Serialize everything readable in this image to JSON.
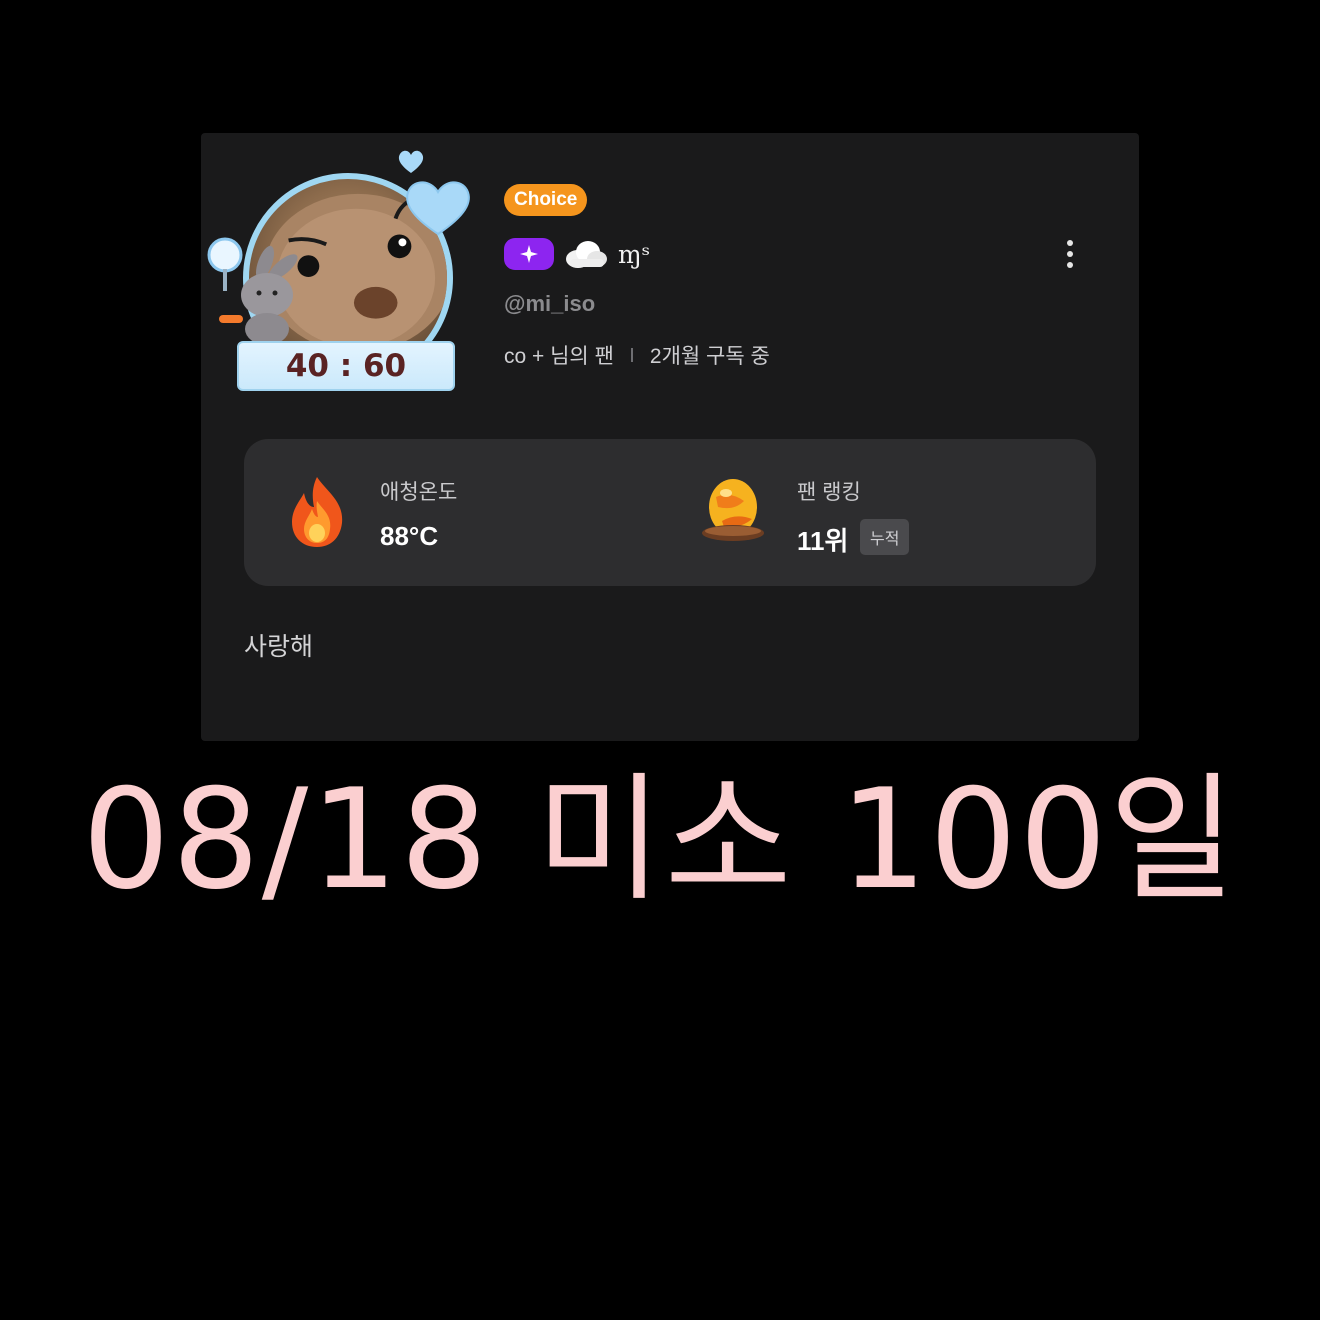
{
  "profile": {
    "score": "40 : 60",
    "choice_label": "Choice",
    "nickname": "ɱˢ",
    "handle": "@mi_iso",
    "fan_of": "co + 님의 팬",
    "subscription": "2개월 구독 중"
  },
  "icons": {
    "avatar": "plush-animal-avatar",
    "star_badge": "sparkle-icon",
    "cloud": "cloud-icon",
    "more": "more-vertical-icon",
    "temperature": "fire-icon",
    "ranking": "egg-nest-icon"
  },
  "stats": {
    "temperature_label": "애청온도",
    "temperature_value": "88°C",
    "ranking_label": "팬 랭킹",
    "ranking_value": "11위",
    "ranking_tag": "누적"
  },
  "message": "사랑해",
  "caption": "08/18 미소 100일",
  "colors": {
    "background": "#000000",
    "card": "#1a1a1b",
    "panel": "#2d2d2f",
    "choice": "#f5951d",
    "star_badge": "#8d25f0",
    "caption": "#fbcfd0",
    "ring": "#9fd7f2"
  }
}
